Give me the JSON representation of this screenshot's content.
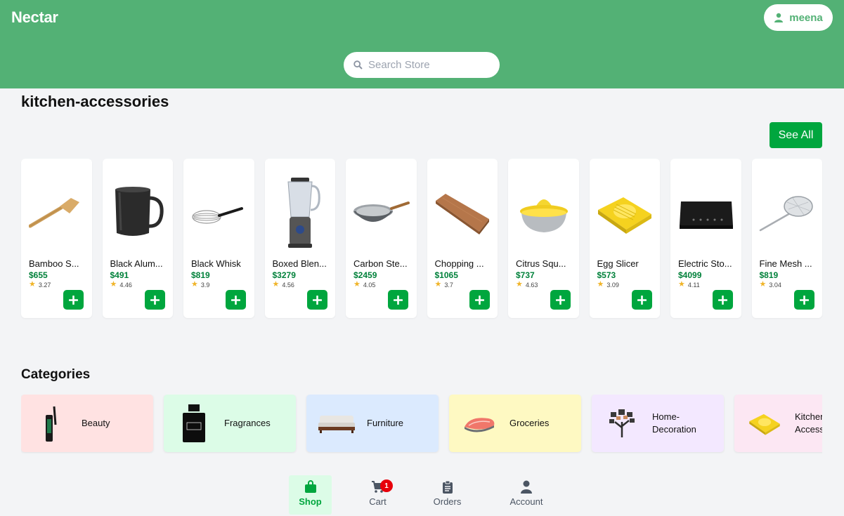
{
  "header": {
    "brand": "Nectar",
    "user_name": "meena",
    "search_placeholder": "Search Store"
  },
  "section": {
    "title": "kitchen-accessories",
    "see_all_label": "See All"
  },
  "products": [
    {
      "name": "Bamboo S...",
      "price": "$655",
      "rating": "3.27",
      "icon": "bamboo-spatula"
    },
    {
      "name": "Black Alum...",
      "price": "$491",
      "rating": "4.46",
      "icon": "black-aluminium-cup"
    },
    {
      "name": "Black Whisk",
      "price": "$819",
      "rating": "3.9",
      "icon": "black-whisk"
    },
    {
      "name": "Boxed Blen...",
      "price": "$3279",
      "rating": "4.56",
      "icon": "boxed-blender"
    },
    {
      "name": "Carbon Ste...",
      "price": "$2459",
      "rating": "4.05",
      "icon": "carbon-steel-wok"
    },
    {
      "name": "Chopping ...",
      "price": "$1065",
      "rating": "3.7",
      "icon": "chopping-board"
    },
    {
      "name": "Citrus Squ...",
      "price": "$737",
      "rating": "4.63",
      "icon": "citrus-squeezer"
    },
    {
      "name": "Egg Slicer",
      "price": "$573",
      "rating": "3.09",
      "icon": "egg-slicer"
    },
    {
      "name": "Electric Sto...",
      "price": "$4099",
      "rating": "4.11",
      "icon": "electric-stove"
    },
    {
      "name": "Fine Mesh ...",
      "price": "$819",
      "rating": "3.04",
      "icon": "fine-mesh-strainer"
    }
  ],
  "categories_title": "Categories",
  "categories": [
    {
      "label": "Beauty",
      "bg": "#ffe2e2",
      "icon": "mascara"
    },
    {
      "label": "Fragrances",
      "bg": "#dcfce7",
      "icon": "perfume-bottle"
    },
    {
      "label": "Furniture",
      "bg": "#dbeafe",
      "icon": "sofa"
    },
    {
      "label": "Groceries",
      "bg": "#fef9c2",
      "icon": "fish-steak"
    },
    {
      "label": "Home-\nDecoration",
      "bg": "#f3e8ff",
      "icon": "photo-tree"
    },
    {
      "label": "Kitchen-\nAccessories",
      "bg": "#fce7f3",
      "icon": "egg-slicer"
    }
  ],
  "nav": {
    "shop": "Shop",
    "cart": "Cart",
    "cart_badge": "1",
    "orders": "Orders",
    "account": "Account"
  },
  "colors": {
    "header": "#53b175",
    "accent": "#00a63e",
    "price": "#00813a",
    "badge": "#e7000b"
  }
}
